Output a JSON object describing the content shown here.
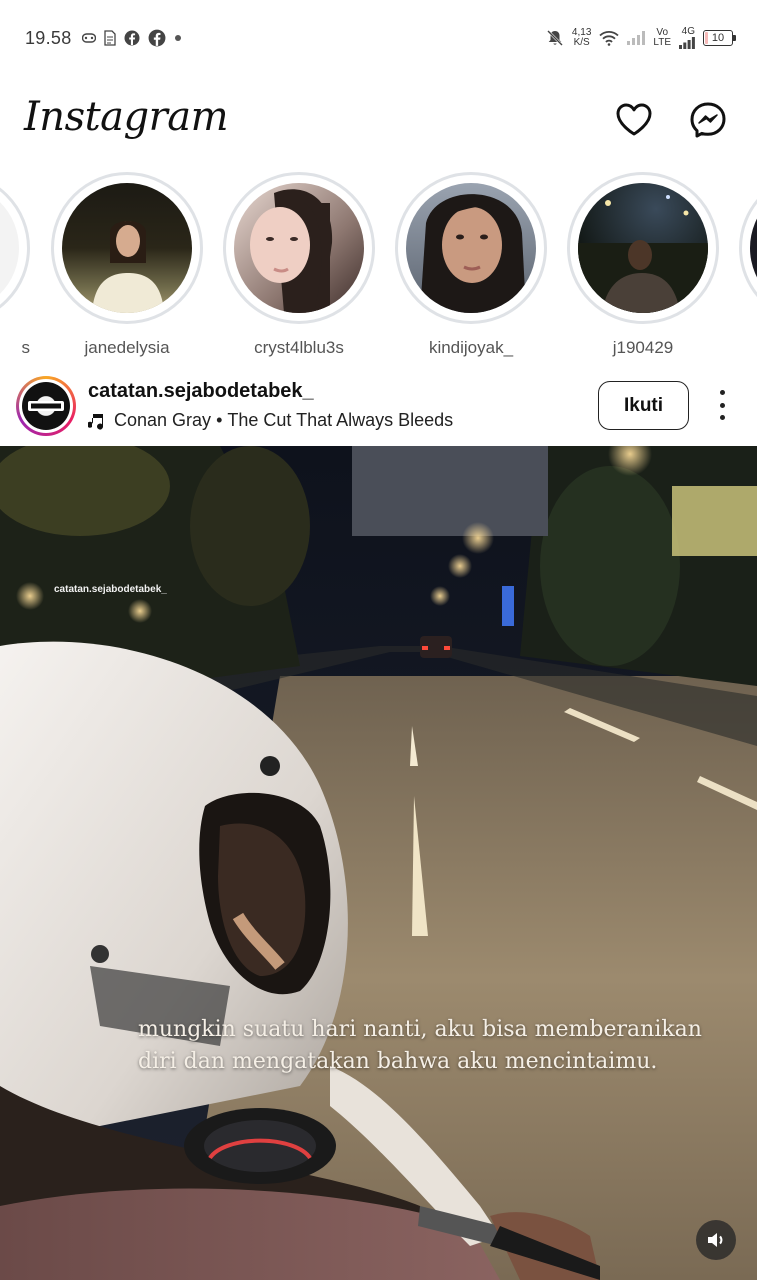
{
  "status_bar": {
    "time": "19.58",
    "net_speed_value": "4,13",
    "net_speed_unit": "K/S",
    "vo_top": "Vo",
    "vo_bottom": "LTE",
    "network": "4G",
    "battery": "10",
    "battery_level": 0.1,
    "battery_color": "#e53935"
  },
  "app": {
    "logo": "Instagram",
    "icons": [
      "heart-icon",
      "messenger-icon"
    ]
  },
  "stories": [
    {
      "username": "s"
    },
    {
      "username": "janedelysia"
    },
    {
      "username": "cryst4lblu3s"
    },
    {
      "username": "kindijoyak_"
    },
    {
      "username": "j190429"
    }
  ],
  "post": {
    "username": "catatan.sejabodetabek_",
    "artist": "Conan Gray",
    "separator": "•",
    "song": "The Cut That Always Bleeds",
    "follow_label": "Ikuti",
    "media": {
      "watermark": "catatan.sejabodetabek_",
      "caption_line1": "mungkin suatu hari nanti, aku bisa memberanikan",
      "caption_line2": "diri dan mengatakan bahwa aku mencintaimu."
    }
  }
}
